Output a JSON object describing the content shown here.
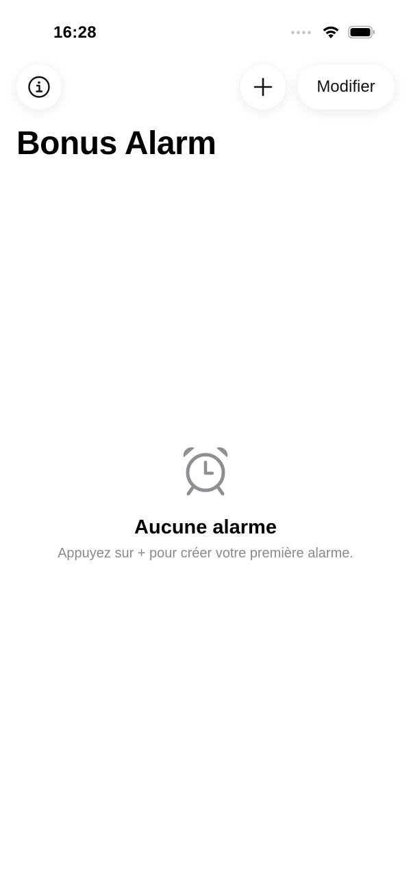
{
  "status_bar": {
    "time": "16:28"
  },
  "nav": {
    "info_icon": "info-circle-icon",
    "add_icon": "plus-icon",
    "edit_label": "Modifier"
  },
  "page": {
    "title": "Bonus Alarm"
  },
  "empty_state": {
    "icon": "alarm-clock-icon",
    "title": "Aucune alarme",
    "subtitle": "Appuyez sur + pour créer votre première alarme."
  },
  "colors": {
    "background": "#ffffff",
    "text_primary": "#000000",
    "text_secondary": "#8a8a8e",
    "icon_gray": "#8e8e93"
  }
}
